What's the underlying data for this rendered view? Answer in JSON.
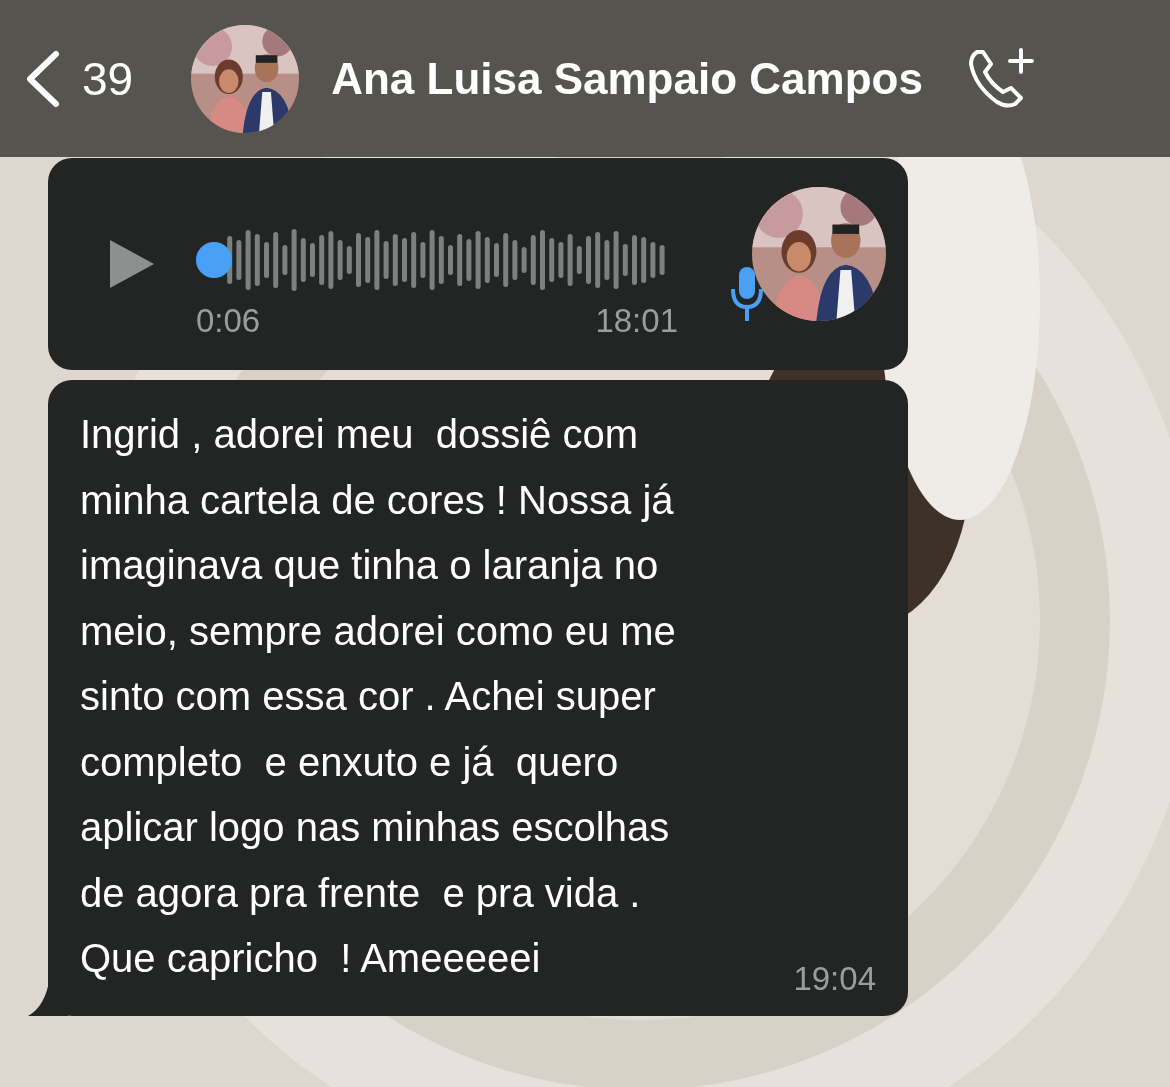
{
  "header": {
    "back_count": "39",
    "contact_name": "Ana Luisa Sampaio Campos"
  },
  "messages": [
    {
      "kind": "voice",
      "duration": "0:06",
      "time": "18:01"
    },
    {
      "kind": "text",
      "text": "Ingrid , adorei meu  dossiê com\nminha cartela de cores ! Nossa já\nimaginava que tinha o laranja no\nmeio, sempre adorei como eu me\nsinto com essa cor . Achei super\ncompleto  e enxuto e já  quero\naplicar logo nas minhas escolhas\nde agora pra frente  e pra vida .\nQue capricho  ! Ameeeeei",
      "time": "19:04"
    }
  ]
}
